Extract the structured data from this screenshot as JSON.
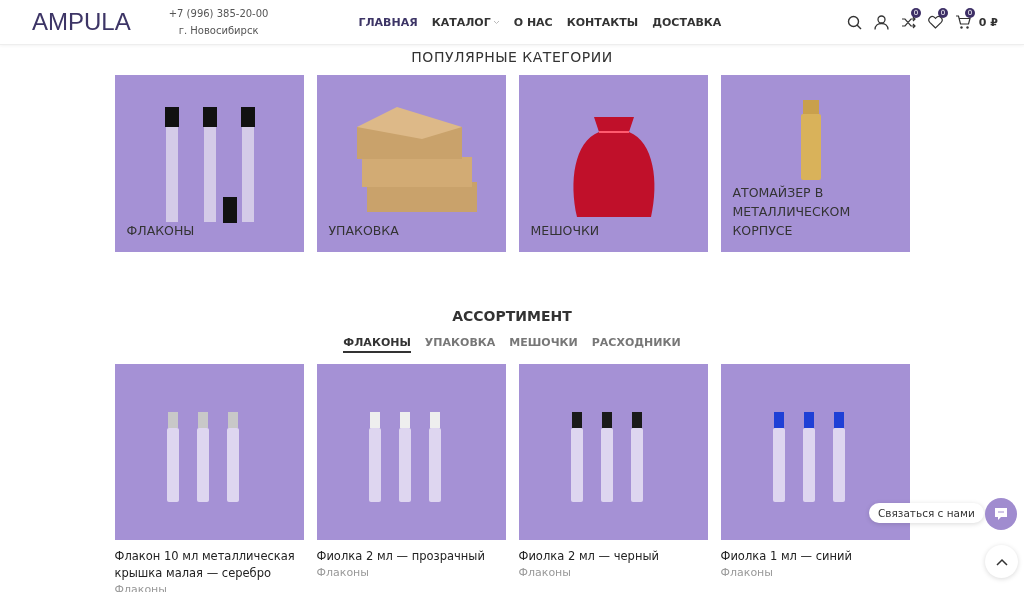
{
  "header": {
    "logo": "AMPULA",
    "phone": "+7 (996) 385-20-00",
    "city": "г. Новосибирск",
    "nav": [
      {
        "label": "ГЛАВНАЯ",
        "selected": true,
        "dropdown": false
      },
      {
        "label": "КАТАЛОГ",
        "selected": false,
        "dropdown": true
      },
      {
        "label": "О НАС",
        "selected": false,
        "dropdown": false
      },
      {
        "label": "КОНТАКТЫ",
        "selected": false,
        "dropdown": false
      },
      {
        "label": "ДОСТАВКА",
        "selected": false,
        "dropdown": false
      }
    ],
    "compare_count": "0",
    "wishlist_count": "0",
    "cart_count": "0",
    "cart_total": "0 ₽"
  },
  "categories": {
    "title": "ПОПУЛЯРНЫЕ КАТЕГОРИИ",
    "items": [
      {
        "label": "ФЛАКОНЫ",
        "kind": "bottles"
      },
      {
        "label": "УПАКОВКА",
        "kind": "boxes"
      },
      {
        "label": "МЕШОЧКИ",
        "kind": "pouch"
      },
      {
        "label": "АТОМАЙЗЕР В МЕТАЛЛИЧЕСКОМ КОРПУСЕ",
        "kind": "atomizer"
      }
    ]
  },
  "assortment": {
    "title": "АССОРТИМЕНТ",
    "tabs": [
      {
        "label": "ФЛАКОНЫ",
        "selected": true
      },
      {
        "label": "УПАКОВКА",
        "selected": false
      },
      {
        "label": "МЕШОЧКИ",
        "selected": false
      },
      {
        "label": "РАСХОДНИКИ",
        "selected": false
      }
    ],
    "products": [
      {
        "name": "Флакон 10 мл металлическая крышка малая — серебро",
        "category": "Флаконы",
        "color": "#c8c8c8"
      },
      {
        "name": "Фиолка 2 мл — прозрачный",
        "category": "Флаконы",
        "color": "#eeeeee"
      },
      {
        "name": "Фиолка 2 мл — черный",
        "category": "Флаконы",
        "color": "#1a1a1a"
      },
      {
        "name": "Фиолка 1 мл — синий",
        "category": "Флаконы",
        "color": "#1f3fd6"
      }
    ]
  },
  "contact": {
    "label": "Связаться с нами"
  }
}
